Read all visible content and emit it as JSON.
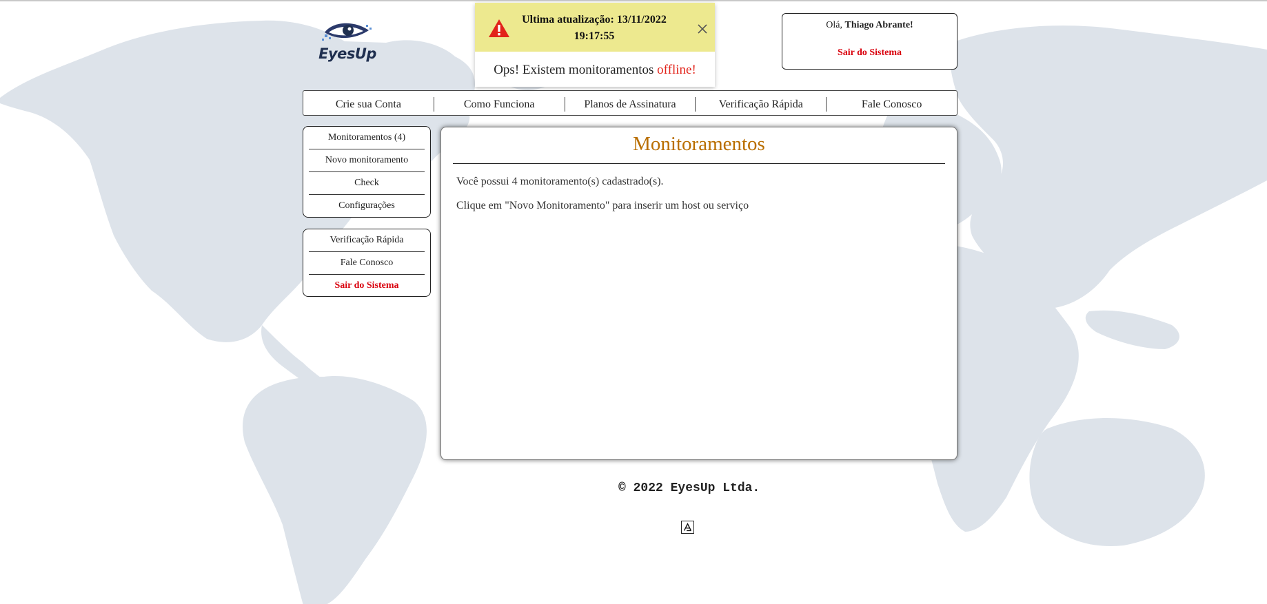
{
  "logo": {
    "text": "EyesUp",
    "icon": "eye-logo-icon"
  },
  "toast": {
    "icon": "warning-triangle-icon",
    "title": "Ultima atualização: 13/11/2022 19:17:55",
    "message_prefix": "Ops! Existem monitoramentos ",
    "message_highlight": "offline!",
    "close_icon": "close-icon",
    "colors": {
      "header_bg": "#ede98f",
      "warning": "#e2231a",
      "highlight": "#e2231a"
    }
  },
  "user": {
    "greeting": "Olá, ",
    "name": "Thiago Abrante!",
    "logout": "Sair do Sistema"
  },
  "nav": {
    "items": [
      "Crie sua Conta",
      "Como Funciona",
      "Planos de Assinatura",
      "Verificação Rápida",
      "Fale Conosco"
    ]
  },
  "sidebar": {
    "menu1": [
      "Monitoramentos (4)",
      "Novo monitoramento",
      "Check",
      "Configurações"
    ],
    "menu2": [
      "Verificação Rápida",
      "Fale Conosco",
      "Sair do Sistema"
    ]
  },
  "main": {
    "title": "Monitoramentos",
    "p1": "Você possui 4 monitoramento(s) cadastrado(s).",
    "p2": "Clique em \"Novo Monitoramento\" para inserir um host ou serviço",
    "colors": {
      "title": "#b96e00"
    }
  },
  "footer": {
    "copyright": "© 2022 EyesUp Ltda."
  },
  "badge": {
    "icon": "accessibility-badge-icon"
  },
  "colors": {
    "map": "#dde3ea",
    "accent_red": "#d9000d"
  }
}
